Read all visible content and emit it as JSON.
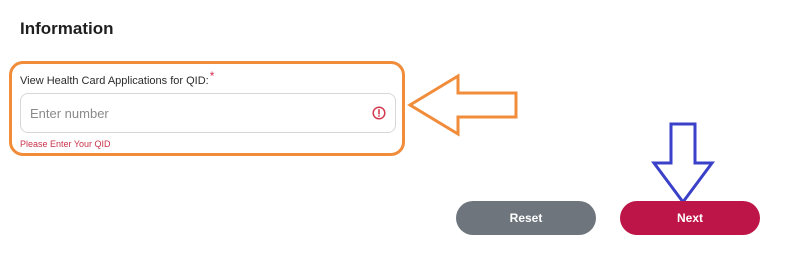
{
  "section": {
    "title": "Information"
  },
  "field": {
    "label": "View Health Card Applications for QID:",
    "required_marker": "*",
    "placeholder": "Enter number",
    "value": "",
    "error_message": "Please Enter Your QID"
  },
  "buttons": {
    "reset_label": "Reset",
    "next_label": "Next"
  },
  "icons": {
    "input_status": "error-circle-icon",
    "annotation_left": "arrow-left-icon",
    "annotation_down": "arrow-down-icon"
  },
  "colors": {
    "highlight_orange": "#f08c3a",
    "annotation_blue": "#3b40c8",
    "error_red": "#c8334a",
    "next_button": "#bd1547",
    "reset_button": "#6e757c"
  }
}
